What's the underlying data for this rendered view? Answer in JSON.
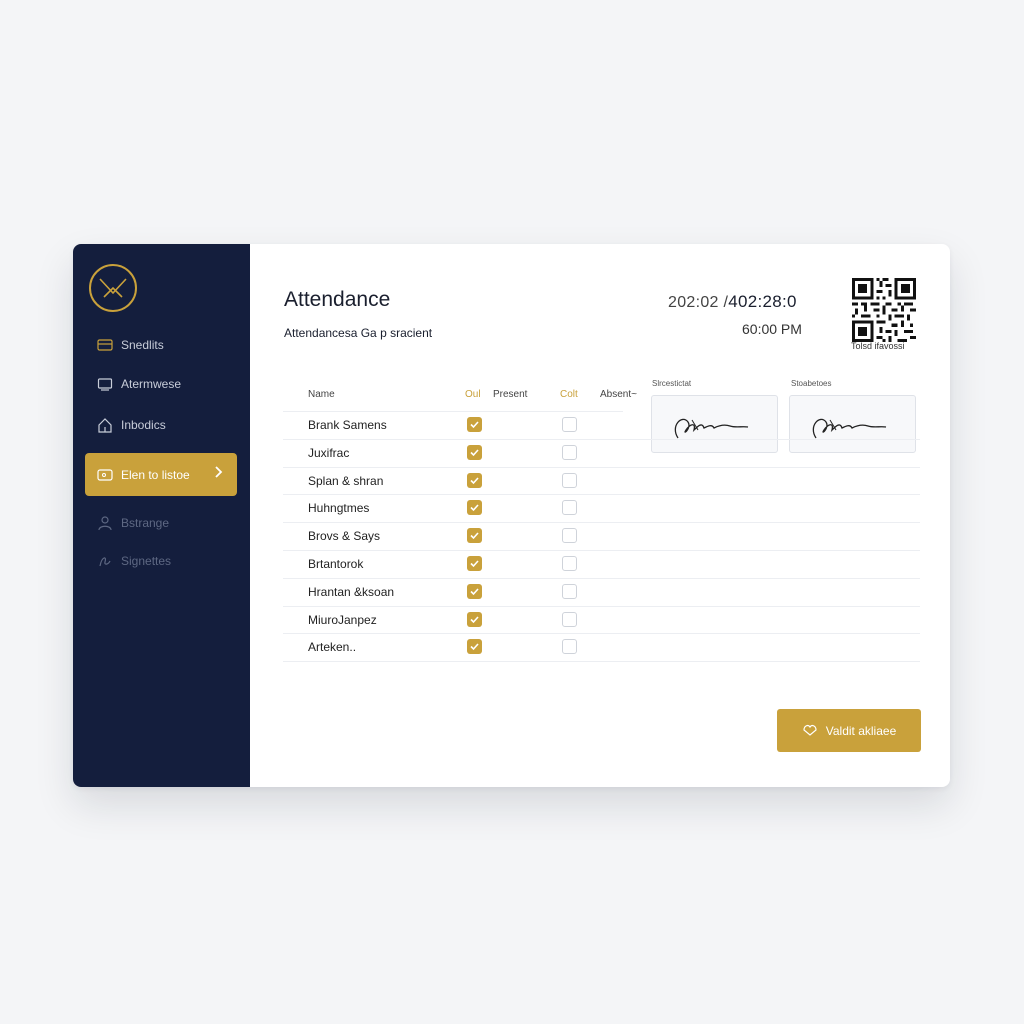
{
  "sidebar": {
    "items": [
      {
        "label": "Snedlits",
        "icon": "card-icon"
      },
      {
        "label": "Atermwese",
        "icon": "monitor-icon"
      },
      {
        "label": "Inbodics",
        "icon": "home-icon"
      },
      {
        "label": "Elen to listoe",
        "icon": "wallet-icon",
        "active": true
      },
      {
        "label": "Bstrange",
        "icon": "users-icon"
      },
      {
        "label": "Signettes",
        "icon": "signature-icon"
      }
    ]
  },
  "header": {
    "title": "Attendance",
    "subtitle": "Attendancesa Ga p sracient",
    "date_prefix": "202:02 /",
    "date_main": "402:28:0",
    "time": "60:00 PM",
    "qr_caption": "Tolsd ifavossi"
  },
  "table": {
    "columns": {
      "name": "Name",
      "out": "Oul",
      "present": "Present",
      "colt": "Colt",
      "absent": "Absent~"
    },
    "rows": [
      {
        "name": "Brank Samens",
        "present": true,
        "absent": false
      },
      {
        "name": "Juxifrac",
        "present": true,
        "absent": false
      },
      {
        "name": "Splan & shran",
        "present": true,
        "absent": false
      },
      {
        "name": "Huhngtmes",
        "present": true,
        "absent": false
      },
      {
        "name": "Brovs & Says",
        "present": true,
        "absent": false
      },
      {
        "name": "Brtantorok",
        "present": true,
        "absent": false
      },
      {
        "name": "Hrantan &ksoan",
        "present": true,
        "absent": false
      },
      {
        "name": "MiuroJanpez",
        "present": true,
        "absent": false
      },
      {
        "name": "Arteken..",
        "present": true,
        "absent": false
      }
    ]
  },
  "signatures": {
    "label_1": "Slrcestictat",
    "label_2": "Stoabetoes"
  },
  "actions": {
    "validate_label": "Valdit akliaee"
  },
  "colors": {
    "sidebar_bg": "#141e3d",
    "accent_gold": "#c9a13b",
    "background": "#f4f5f7"
  }
}
